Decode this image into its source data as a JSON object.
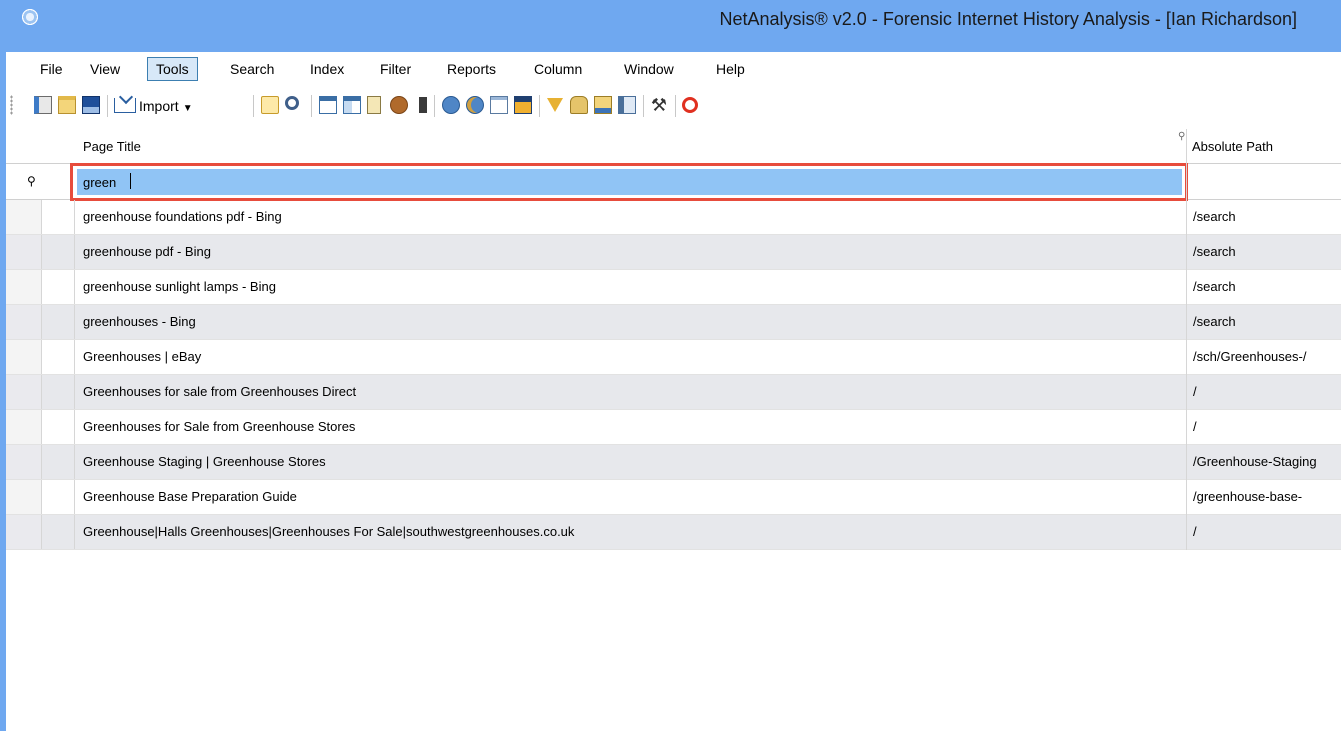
{
  "window": {
    "title": "NetAnalysis® v2.0 - Forensic Internet History Analysis - [Ian Richardson]"
  },
  "menu": {
    "items": [
      "File",
      "View",
      "Tools",
      "Search",
      "Index",
      "Filter",
      "Reports",
      "Column",
      "Window",
      "Help"
    ],
    "active": "Tools"
  },
  "toolbar": {
    "import_label": "Import",
    "icons": [
      "new-workspace-icon",
      "open-folder-icon",
      "save-icon",
      "import-icon",
      "filter-edit-icon",
      "find-icon",
      "table-view-icon",
      "grid-view-icon",
      "report-icon",
      "cookie-icon",
      "bookmark-icon",
      "refresh-icon",
      "refresh-alt-icon",
      "list-icon",
      "image-icon",
      "filter-icon",
      "database-icon",
      "export-icon",
      "properties-icon",
      "tools-icon",
      "power-icon"
    ]
  },
  "grid": {
    "columns": {
      "page_title": "Page Title",
      "absolute_path": "Absolute Path"
    },
    "filter_value": "green",
    "rows": [
      {
        "title": "greenhouse foundations pdf - Bing",
        "path": "/search"
      },
      {
        "title": "greenhouse pdf - Bing",
        "path": "/search"
      },
      {
        "title": "greenhouse sunlight lamps - Bing",
        "path": "/search"
      },
      {
        "title": "greenhouses - Bing",
        "path": "/search"
      },
      {
        "title": "Greenhouses | eBay",
        "path": "/sch/Greenhouses-/"
      },
      {
        "title": "Greenhouses for sale from Greenhouses Direct",
        "path": "/"
      },
      {
        "title": "Greenhouses for Sale from Greenhouse Stores",
        "path": "/"
      },
      {
        "title": "Greenhouse Staging | Greenhouse Stores",
        "path": "/Greenhouse-Staging"
      },
      {
        "title": "Greenhouse Base Preparation Guide",
        "path": "/greenhouse-base-"
      },
      {
        "title": "Greenhouse|Halls Greenhouses|Greenhouses For Sale|southwestgreenhouses.co.uk",
        "path": "/"
      }
    ]
  },
  "colors": {
    "titlebar": "#6fa8f0",
    "filter_highlight": "#90c4f5",
    "focus_border": "#e74c3c",
    "alt_row": "#e7e8ec"
  }
}
